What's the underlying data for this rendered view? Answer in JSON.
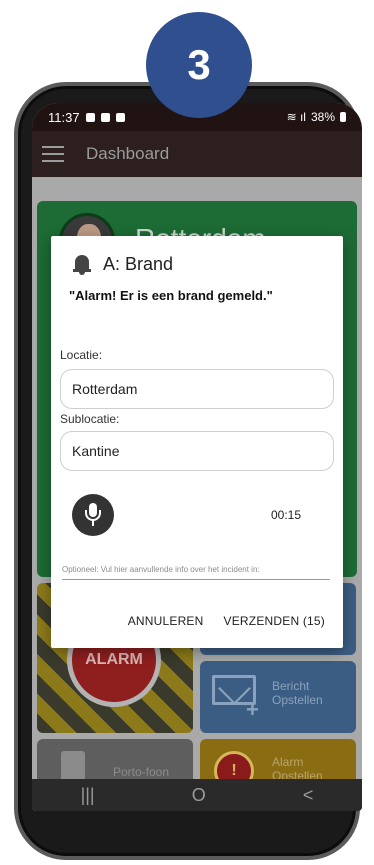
{
  "step": {
    "number": "3",
    "color": "#2f4f8f"
  },
  "statusbar": {
    "time": "11:37",
    "battery": "38%"
  },
  "appbar": {
    "title": "Dashboard"
  },
  "dashboard": {
    "location_name": "Rotterdam",
    "tiles": {
      "alarm": "ALARM",
      "message": "Bericht\nOpstellen",
      "radio": "Porto-foon",
      "alarm_compose": "Alarm\nOpstellen"
    }
  },
  "dialog": {
    "title": "A: Brand",
    "message": "\"Alarm! Er is een brand gemeld.\"",
    "location_label": "Locatie:",
    "location_value": "Rotterdam",
    "sublocation_label": "Sublocatie:",
    "sublocation_value": "Kantine",
    "timer": "00:15",
    "extra_placeholder": "Optioneel: Vul hier aanvullende info over het incident in:",
    "cancel_label": "ANNULEREN",
    "send_label": "VERZENDEN (15)"
  },
  "navbar": {
    "recent": "|||",
    "home": "O",
    "back": "<"
  }
}
